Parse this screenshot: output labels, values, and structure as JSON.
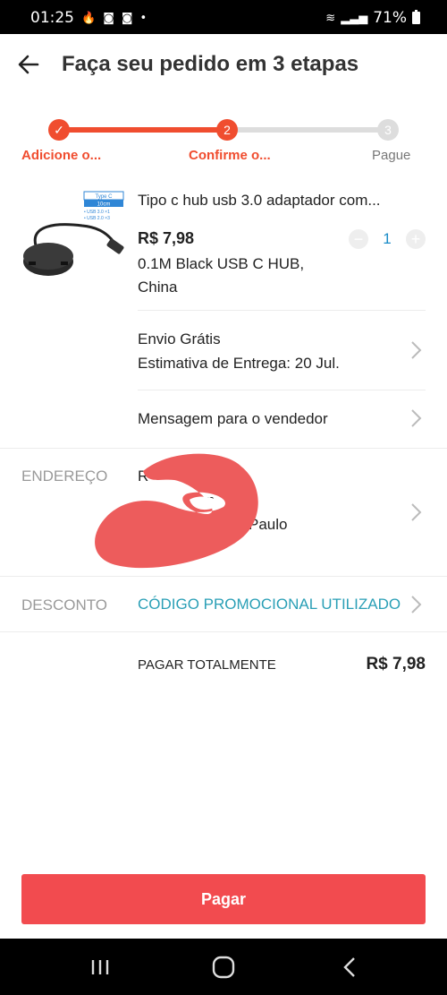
{
  "status_bar": {
    "time": "01:25",
    "battery": "71%"
  },
  "header": {
    "title": "Faça seu pedido em 3 etapas"
  },
  "steps": [
    {
      "label": "Adicione o...",
      "number": "✓",
      "state": "done"
    },
    {
      "label": "Confirme o...",
      "number": "2",
      "state": "current"
    },
    {
      "label": "Pague",
      "number": "3",
      "state": "pending"
    }
  ],
  "product": {
    "title": "Tipo c hub usb 3.0 adaptador com...",
    "price": "R$ 7,98",
    "variant_line1": "0.1M Black USB C HUB,",
    "variant_line2": "China",
    "quantity": "1",
    "image_text": {
      "label": "Type C",
      "length": "10cm",
      "spec1": "• USB 3.0 ×1",
      "spec2": "• USB 2.0 ×3"
    }
  },
  "shipping": {
    "line1": "Envio Grátis",
    "line2": "Estimativa de Entrega: 20 Jul."
  },
  "message": {
    "label": "Mensagem para o vendedor"
  },
  "address": {
    "label": "ENDEREÇO",
    "line1": "R",
    "line2": "unn",
    "line3": "Paulo"
  },
  "discount": {
    "label": "DESCONTO",
    "value": "CÓDIGO PROMOCIONAL UTILIZADO"
  },
  "total": {
    "label": "PAGAR TOTALMENTE",
    "value": "R$ 7,98"
  },
  "pay_button": {
    "label": "Pagar"
  },
  "colors": {
    "accent": "#f24b4f",
    "step_red": "#f04d2f",
    "promo": "#2a9fb6",
    "qty": "#1a8cc8"
  }
}
